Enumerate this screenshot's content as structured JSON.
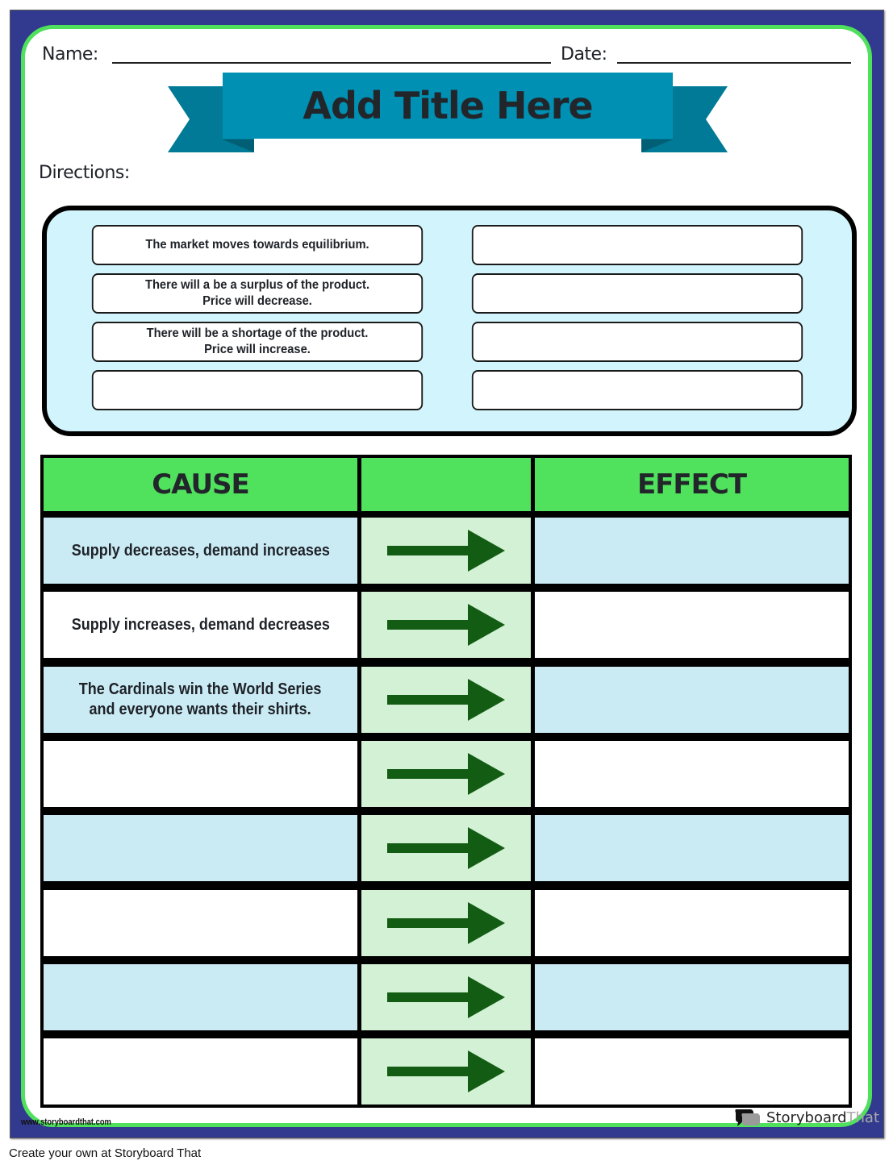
{
  "header": {
    "name_label": "Name:",
    "date_label": "Date:",
    "title": "Add Title Here",
    "directions_label": "Directions:"
  },
  "word_bank": {
    "left": [
      "The market moves towards equilibrium.",
      "There will a be a surplus of the product.\nPrice will decrease.",
      "There will be a shortage of the product.\nPrice will increase.",
      ""
    ],
    "right": [
      "",
      "",
      "",
      ""
    ]
  },
  "table": {
    "headers": {
      "cause": "CAUSE",
      "arrow": "",
      "effect": "EFFECT"
    },
    "rows": [
      {
        "cause": "Supply decreases, demand increases",
        "effect": "",
        "shade": "blue"
      },
      {
        "cause": "Supply increases, demand decreases",
        "effect": "",
        "shade": "white"
      },
      {
        "cause": "The Cardinals win the World Series\nand everyone wants their shirts.",
        "effect": "",
        "shade": "blue"
      },
      {
        "cause": "",
        "effect": "",
        "shade": "white"
      },
      {
        "cause": "",
        "effect": "",
        "shade": "blue"
      },
      {
        "cause": "",
        "effect": "",
        "shade": "white"
      },
      {
        "cause": "",
        "effect": "",
        "shade": "blue"
      },
      {
        "cause": "",
        "effect": "",
        "shade": "white"
      }
    ],
    "arrow_icon": "right-arrow-icon"
  },
  "footer": {
    "url": "www.storyboardthat.com",
    "brand_dark": "Storyboard",
    "brand_light": "That",
    "create_text": "Create your own at Storyboard That"
  },
  "colors": {
    "frame": "#323a8f",
    "border_green": "#4fe05c",
    "ribbon": "#0090b3",
    "ribbon_dark": "#007a96",
    "header_green": "#50e15d",
    "row_blue": "#cbebf4",
    "arrow_cell": "#d3f1d4",
    "arrow": "#135c14",
    "bank_bg": "#d2f5fd"
  }
}
